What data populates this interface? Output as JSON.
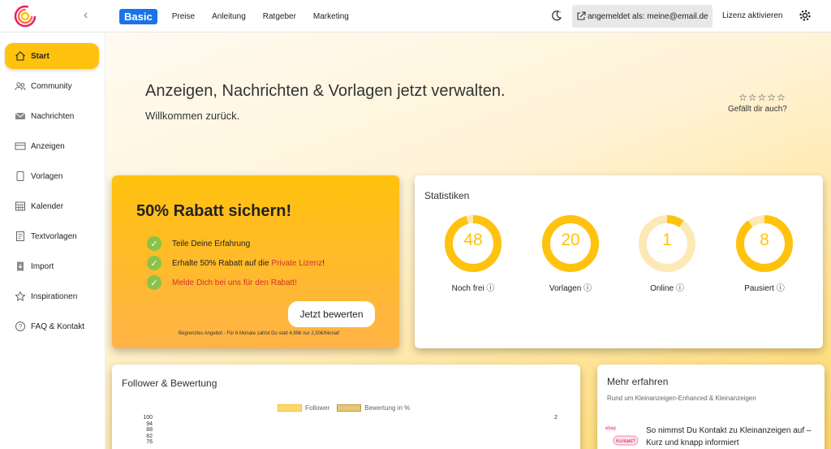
{
  "nav": {
    "badge": "Basic",
    "links": [
      "Preise",
      "Anleitung",
      "Ratgeber",
      "Marketing"
    ],
    "login_text": "angemeldet als: meine@email.de",
    "license": "Lizenz aktivieren"
  },
  "sidebar": {
    "items": [
      {
        "label": "Start",
        "icon": "home-icon"
      },
      {
        "label": "Community",
        "icon": "users-icon"
      },
      {
        "label": "Nachrichten",
        "icon": "mail-icon"
      },
      {
        "label": "Anzeigen",
        "icon": "ads-icon"
      },
      {
        "label": "Vorlagen",
        "icon": "template-icon"
      },
      {
        "label": "Kalender",
        "icon": "calendar-icon"
      },
      {
        "label": "Textvorlagen",
        "icon": "text-template-icon"
      },
      {
        "label": "Import",
        "icon": "import-icon"
      },
      {
        "label": "Inspirationen",
        "icon": "star-icon"
      },
      {
        "label": "FAQ & Kontakt",
        "icon": "help-icon"
      }
    ]
  },
  "hero": {
    "title": "Anzeigen, Nachrichten & Vorlagen jetzt verwalten.",
    "subtitle": "Willkommen zurück.",
    "stars": "☆☆☆☆☆",
    "rating_prompt": "Gefällt dir auch?"
  },
  "promo": {
    "title": "50% Rabatt sichern!",
    "item1": "Teile Deine Erfahrung",
    "item2_pre": "Erhalte 50% Rabatt auf die ",
    "item2_link": "Private Lizenz",
    "item2_post": "!",
    "item3": "Melde Dich bei uns für den Rabatt!",
    "button": "Jetzt bewerten",
    "footnote": "Begrenztes Angebot - Für 6 Monate zahlst Du statt 4,99€ nur 2,50€/Monat!"
  },
  "stats": {
    "title": "Statistiken",
    "items": [
      {
        "value": "48",
        "label": "Noch frei",
        "fraction": 0.96
      },
      {
        "value": "20",
        "label": "Vorlagen",
        "fraction": 1.0
      },
      {
        "value": "1",
        "label": "Online",
        "fraction": 0.1
      },
      {
        "value": "8",
        "label": "Pausiert",
        "fraction": 0.9
      }
    ],
    "accent": "#ffc20e",
    "track": "#fde9b6"
  },
  "follower": {
    "title": "Follower & Bewertung",
    "legend1": "Follower",
    "legend2": "Bewertung in %",
    "yticks": [
      "100",
      "94",
      "88",
      "82",
      "76"
    ],
    "y2tick": "2"
  },
  "more": {
    "title": "Mehr erfahren",
    "subtitle": "Rund um Kleinanzeigen-Enhanced & Kleinanzeigen",
    "article": "So nimmst Du Kontakt zu Kleinanzeigen auf – Kurz und knapp informiert",
    "thumb_label": "Kontakt?"
  }
}
